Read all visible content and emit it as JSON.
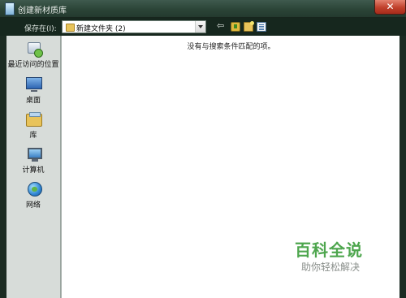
{
  "window": {
    "title": "创建新材质库",
    "close_label": "✕"
  },
  "toolbar": {
    "save_in_label": "保存在(I):",
    "path_value": "新建文件夹 (2)",
    "back_glyph": "⇦"
  },
  "sidebar": {
    "items": [
      {
        "label": "最近访问的位置",
        "icon": "recent-places-icon"
      },
      {
        "label": "桌面",
        "icon": "desktop-icon"
      },
      {
        "label": "库",
        "icon": "libraries-icon"
      },
      {
        "label": "计算机",
        "icon": "computer-icon"
      },
      {
        "label": "网络",
        "icon": "network-icon"
      }
    ]
  },
  "content": {
    "empty_message": "没有与搜索条件匹配的项。"
  },
  "watermark": {
    "main": "百科全说",
    "sub": "助你轻松解决"
  },
  "colors": {
    "frame": "#1b2b22",
    "sidebar_bg": "#d7dcd9",
    "watermark_green": "#4ea64e"
  }
}
